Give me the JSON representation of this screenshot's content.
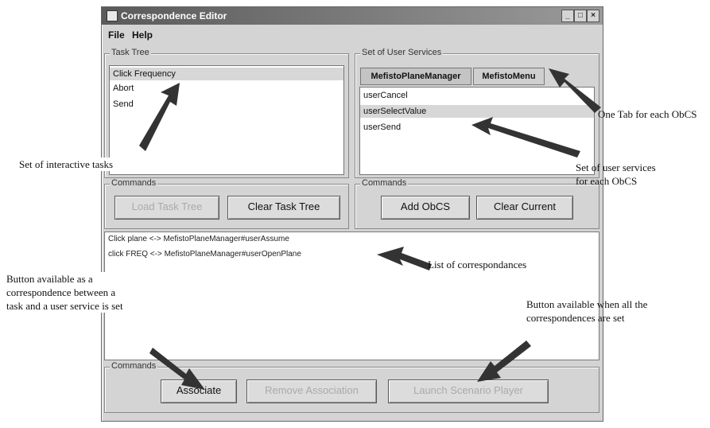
{
  "window": {
    "title": "Correspondence Editor",
    "minimize_glyph": "_",
    "maximize_glyph": "□",
    "close_glyph": "×"
  },
  "menu": {
    "file": "File",
    "help": "Help"
  },
  "task_tree": {
    "label": "Task Tree",
    "items": [
      "Click Frequency",
      "Abort",
      "Send"
    ],
    "selected_index": 0
  },
  "user_services": {
    "label": "Set of User Services",
    "tabs": [
      "MefistoPlaneManager",
      "MefistoMenu"
    ],
    "active_tab_index": 0,
    "items": [
      "userCancel",
      "userSelectValue",
      "userSend"
    ],
    "selected_index": 1
  },
  "left_commands": {
    "label": "Commands",
    "load": "Load Task Tree",
    "clear": "Clear Task Tree"
  },
  "right_commands": {
    "label": "Commands",
    "add": "Add ObCS",
    "clear": "Clear Current"
  },
  "correspondences": [
    "Click plane <-> MefistoPlaneManager#userAssume",
    "click FREQ <-> MefistoPlaneManager#userOpenPlane"
  ],
  "bottom_commands": {
    "label": "Commands",
    "associate": "Associate",
    "remove": "Remove Association",
    "launch": "Launch Scenario Player"
  },
  "annotations": {
    "one_tab": "One Tab for each ObCS",
    "interactive_tasks": "Set of interactive tasks",
    "user_services_1": "Set of user services",
    "user_services_2": "for each ObCS",
    "list_corr": "List of correspondances",
    "button_assoc": "Button available as a\ncorrespondence between a\ntask and a user service is set",
    "button_all": "Button available when all the\ncorrespondences are set"
  }
}
